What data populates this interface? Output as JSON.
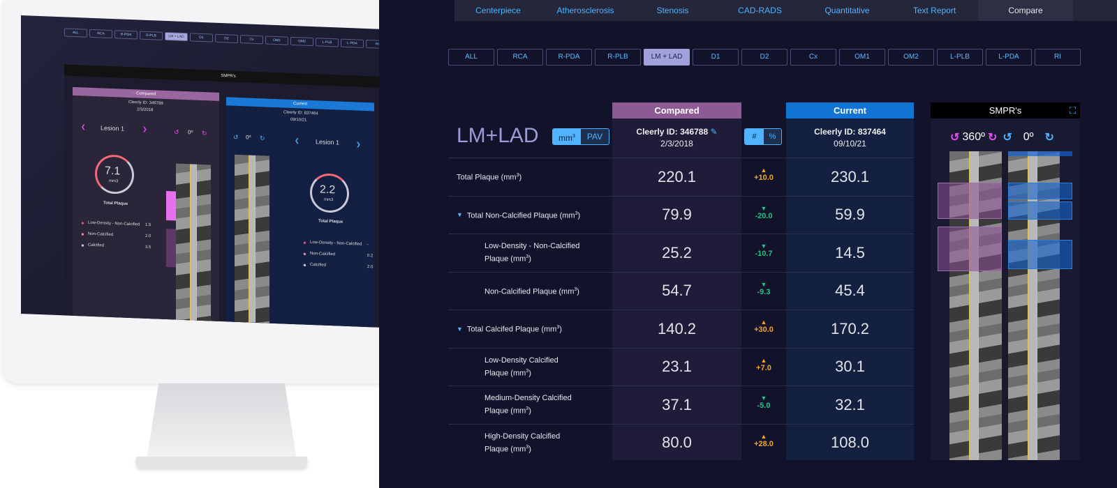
{
  "tabs": [
    {
      "label": "Centerpiece"
    },
    {
      "label": "Atherosclerosis"
    },
    {
      "label": "Stenosis"
    },
    {
      "label": "CAD-RADS"
    },
    {
      "label": "Quantitative"
    },
    {
      "label": "Text Report"
    },
    {
      "label": "Compare",
      "active": true
    }
  ],
  "segments": [
    "ALL",
    "RCA",
    "R-PDA",
    "R-PLB",
    "LM + LAD",
    "D1",
    "D2",
    "Cx",
    "OM1",
    "OM2",
    "L-PLB",
    "L-PDA",
    "RI"
  ],
  "active_segment": "LM + LAD",
  "vessel_title": "LM+LAD",
  "unit_toggle": {
    "mm": "mm",
    "pav": "PAV",
    "selected": "mm3"
  },
  "num_toggle": {
    "hash": "#",
    "pct": "%",
    "selected": "#"
  },
  "compared": {
    "header": "Compared",
    "id": "Cleerly ID: 346788",
    "date": "2/3/2018"
  },
  "current": {
    "header": "Current",
    "id": "Cleerly ID: 837464",
    "date": "09/10/21"
  },
  "rows": [
    {
      "label": "Total Plaque (mm",
      "compared": "220.1",
      "delta": "+10.0",
      "dir": "up",
      "current": "230.1"
    },
    {
      "label": "Total Non-Calcified Plaque (mm",
      "compared": "79.9",
      "delta": "-20.0",
      "dir": "down",
      "current": "59.9",
      "expand": true
    },
    {
      "label": "Low-Density - Non-Calcified",
      "label2": "Plaque (mm",
      "compared": "25.2",
      "delta": "-10.7",
      "dir": "down",
      "current": "14.5",
      "sub": true
    },
    {
      "label": "Non-Calcified Plaque (mm",
      "compared": "54.7",
      "delta": "-9.3",
      "dir": "down",
      "current": "45.4",
      "sub": true
    },
    {
      "label": "Total Calcifed Plaque (mm",
      "compared": "140.2",
      "delta": "+30.0",
      "dir": "up",
      "current": "170.2",
      "expand": true
    },
    {
      "label": "Low-Density Calcified",
      "label2": "Plaque (mm",
      "compared": "23.1",
      "delta": "+7.0",
      "dir": "up",
      "current": "30.1",
      "sub": true
    },
    {
      "label": "Medium-Density Calcified",
      "label2": "Plaque (mm",
      "compared": "37.1",
      "delta": "-5.0",
      "dir": "down",
      "current": "32.1",
      "sub": true
    },
    {
      "label": "High-Density Calcified",
      "label2": "Plaque (mm",
      "compared": "80.0",
      "delta": "+28.0",
      "dir": "up",
      "current": "108.0",
      "sub": true
    }
  ],
  "smpr": {
    "title": "SMPR's",
    "left_angle": "360º",
    "right_angle": "0º"
  },
  "colors": {
    "compared": "#8e5a95",
    "current": "#1173d4",
    "up": "#f5a623",
    "down": "#25c283",
    "accent": "#4fb3ff",
    "pink": "#e84ff0"
  },
  "monitor": {
    "smpr_title": "SMPR's",
    "compared": {
      "header": "Compared",
      "id": "Cleerly ID: 346788",
      "date": "2/3/2018",
      "lesion": "Lesion 1",
      "angle": "0º",
      "total": "7.1",
      "unit": "mm3",
      "total_label": "Total Plaque",
      "legend": [
        {
          "label": "Low-Density - Non-Calcified",
          "value": "1.5"
        },
        {
          "label": "Non-Calcified",
          "value": "2.0"
        },
        {
          "label": "Calcified",
          "value": "3.5"
        }
      ],
      "markers": [
        "1",
        "2"
      ]
    },
    "current": {
      "header": "Current",
      "id": "Cleerly ID: 837464",
      "date": "09/10/21",
      "lesion": "Lesion 1",
      "angle": "0º",
      "total": "2.2",
      "unit": "mm3",
      "total_label": "Total Plaque",
      "legend": [
        {
          "label": "Low-Density - Non-Calcified",
          "value": "-"
        },
        {
          "label": "Non-Calcified",
          "value": "0.2"
        },
        {
          "label": "Calcified",
          "value": "2.0"
        }
      ],
      "markers": [
        "1",
        "2",
        "3",
        "4"
      ]
    }
  }
}
